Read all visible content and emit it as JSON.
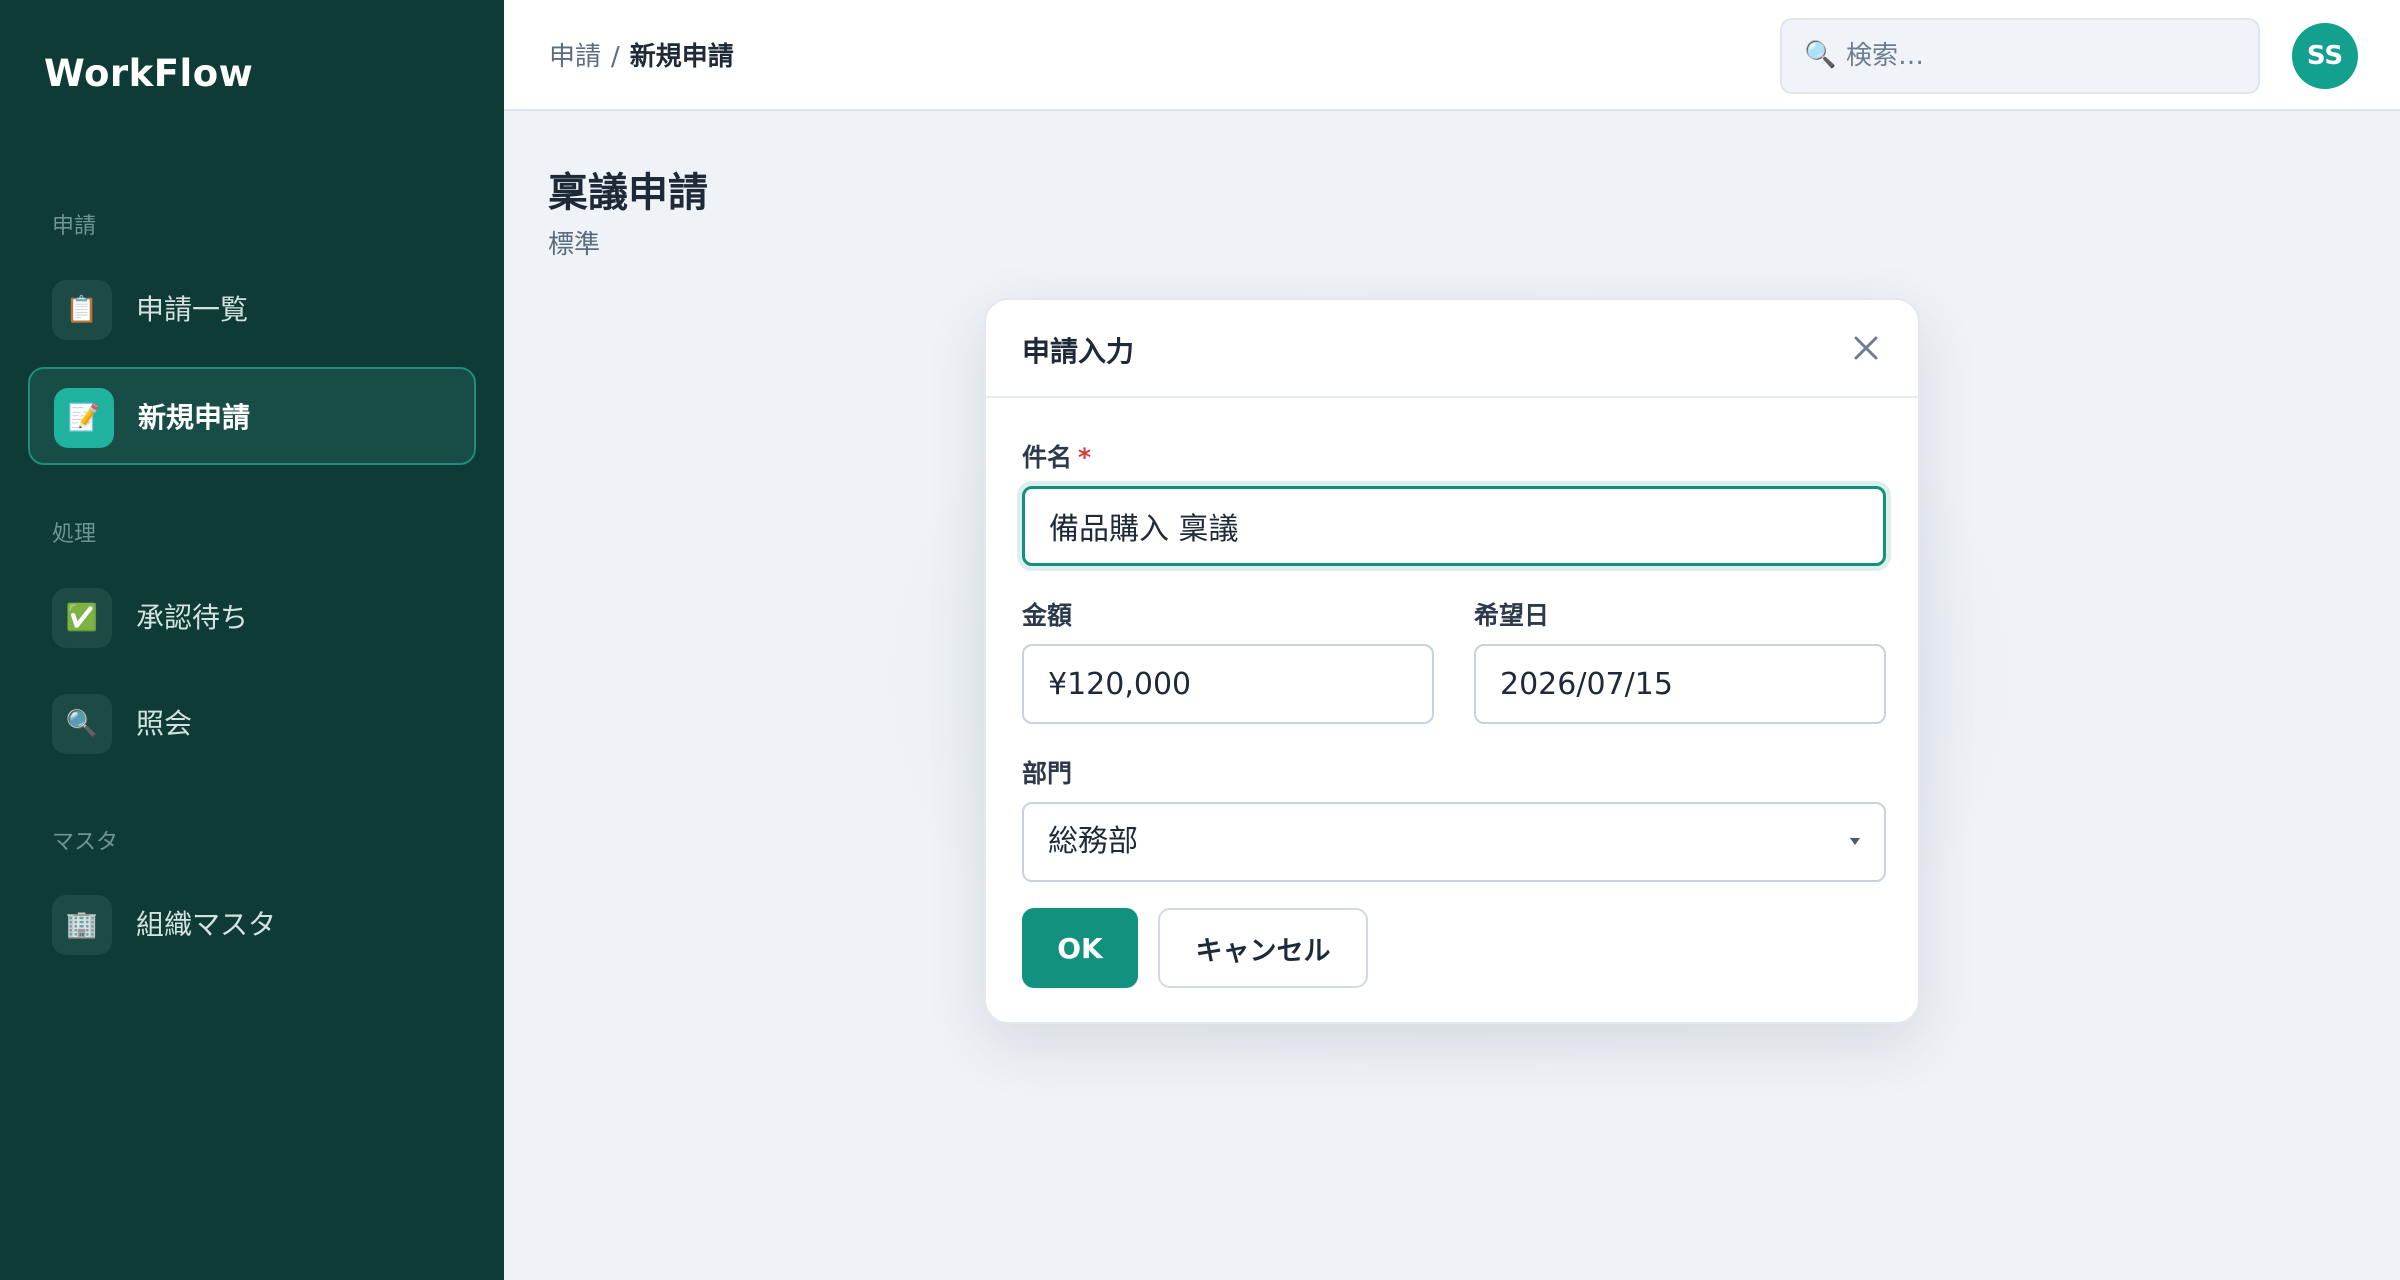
{
  "app": {
    "brand": "WorkFlow"
  },
  "sidebar": {
    "sections": [
      {
        "label": "申請"
      },
      {
        "label": "処理"
      },
      {
        "label": "マスタ"
      }
    ],
    "items": [
      {
        "label": "申請一覧",
        "icon": "📋",
        "icon_name": "clipboard-icon"
      },
      {
        "label": "新規申請",
        "icon": "📝",
        "icon_name": "memo-icon",
        "active": true
      },
      {
        "label": "承認待ち",
        "icon": "✅",
        "icon_name": "check-icon"
      },
      {
        "label": "照会",
        "icon": "🔍",
        "icon_name": "magnifier-icon"
      },
      {
        "label": "組織マスタ",
        "icon": "🏢",
        "icon_name": "building-icon"
      }
    ]
  },
  "header": {
    "breadcrumb": {
      "parent": "申請",
      "separator": "/",
      "current": "新規申請"
    },
    "search": {
      "placeholder": "検索…",
      "icon": "🔍"
    },
    "avatar": {
      "initials": "SS"
    }
  },
  "page": {
    "title": "稟議申請",
    "subtitle": "標準"
  },
  "modal": {
    "title": "申請入力",
    "close_glyph": "×",
    "fields": {
      "subject": {
        "label": "件名",
        "required_mark": "*",
        "value": "備品購入 稟議"
      },
      "amount": {
        "label": "金額",
        "value": "¥120,000"
      },
      "desired_date": {
        "label": "希望日",
        "value": "2026/07/15"
      },
      "department": {
        "label": "部門",
        "value": "総務部"
      }
    },
    "ok_label": "OK",
    "cancel_label": "キャンセル"
  },
  "colors": {
    "sidebar_bg": "#0e3b36",
    "accent": "#13917f",
    "active_icon_bg": "#1fb39f",
    "required": "#d63a3a"
  }
}
